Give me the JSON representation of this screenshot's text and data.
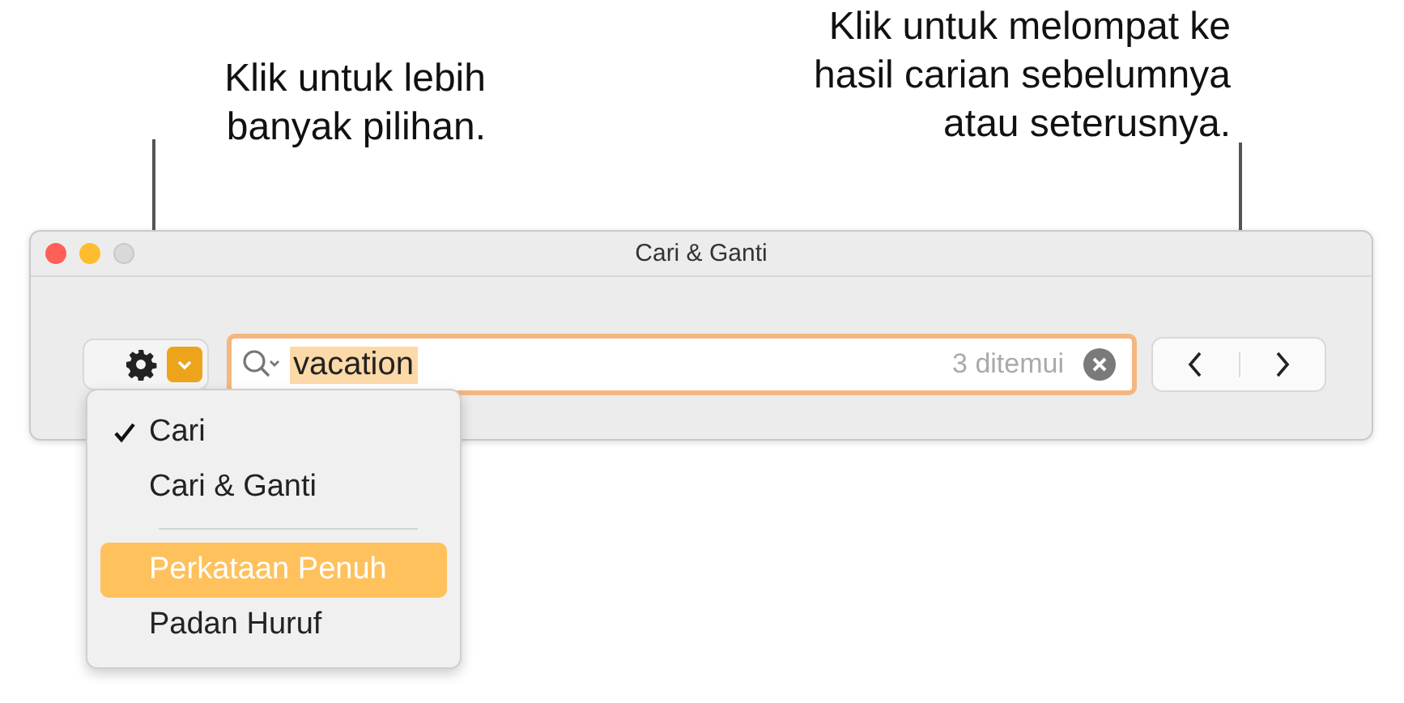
{
  "callouts": [
    {
      "text": "Klik untuk lebih banyak pilihan."
    },
    {
      "text": "Klik untuk melompat ke hasil carian sebelumnya atau seterusnya."
    }
  ],
  "window": {
    "title": "Cari & Ganti"
  },
  "search": {
    "value": "vacation",
    "match_count": "3 ditemui"
  },
  "menu": {
    "items": [
      {
        "kind": "item",
        "label": "Cari",
        "checked": true,
        "selected": false
      },
      {
        "kind": "item",
        "label": "Cari & Ganti",
        "checked": false,
        "selected": false
      },
      {
        "kind": "separator"
      },
      {
        "kind": "item",
        "label": "Perkataan Penuh",
        "checked": false,
        "selected": true
      },
      {
        "kind": "item",
        "label": "Padan Huruf",
        "checked": false,
        "selected": false
      }
    ]
  }
}
